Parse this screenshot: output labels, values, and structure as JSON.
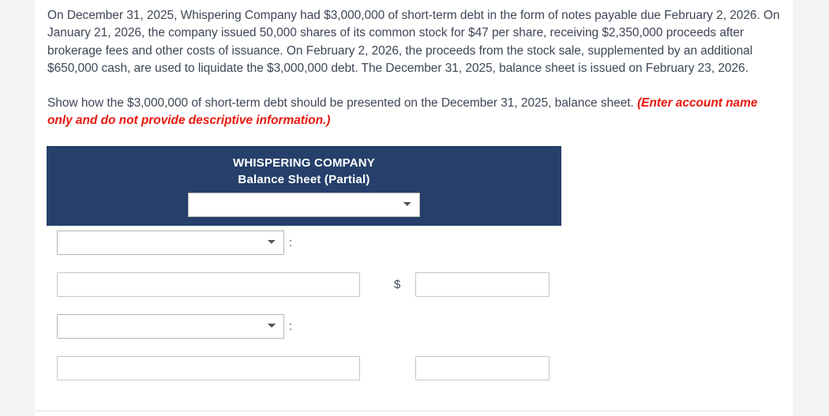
{
  "problem": {
    "intro": "On December 31, 2025, Whispering Company had $3,000,000 of short-term debt in the form of notes payable due February 2, 2026. On January 21, 2026, the company issued 50,000 shares of its common stock for $47 per share, receiving $2,350,000 proceeds after brokerage fees and other costs of issuance. On February 2, 2026, the proceeds from the stock sale, supplemented by an additional $650,000 cash, are used to liquidate the $3,000,000 debt. The December 31, 2025, balance sheet is issued on February 23, 2026.",
    "instruction": "Show how the $3,000,000 of short-term debt should be presented on the December 31, 2025, balance sheet.",
    "hint": "(Enter account name only and do not provide descriptive information.)",
    "hint_color": "#e8180c",
    "text_color": "#3e4756"
  },
  "statement": {
    "header_bg": "#26406b",
    "title": "WHISPERING COMPANY",
    "subtitle": "Balance Sheet (Partial)",
    "header_select": {
      "value": "",
      "options": [
        ""
      ]
    },
    "rows": [
      {
        "type": "account-select",
        "select_value": "",
        "options": [
          ""
        ],
        "separator": ":"
      },
      {
        "type": "label-amount",
        "label_value": "",
        "currency_symbol": "$",
        "amount_value": ""
      },
      {
        "type": "account-select",
        "select_value": "",
        "options": [
          ""
        ],
        "separator": ":"
      },
      {
        "type": "label-amount",
        "label_value": "",
        "currency_symbol": "",
        "amount_value": ""
      }
    ]
  }
}
